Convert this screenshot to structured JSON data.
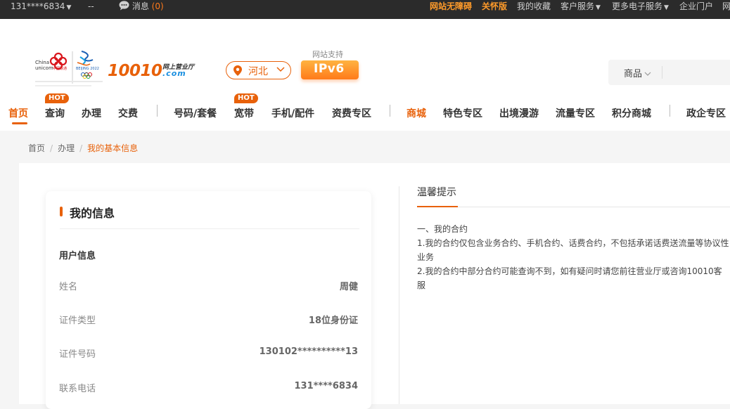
{
  "topbar": {
    "user_phone": "131****6834",
    "dash": "--",
    "messages_label": "消息",
    "messages_count": "(0)",
    "accessible": "网站无障碍",
    "care_mode": "关怀版",
    "favorites": "我的收藏",
    "customer_service": "客户服务",
    "more_services": "更多电子服务",
    "enterprise_portal": "企业门户",
    "truncated": "网"
  },
  "header": {
    "logo_text": "China unicom中国联通",
    "brand_number": "10010",
    "brand_line1": "网上营业厅",
    "brand_line2": ".com",
    "region": "河北",
    "ipv6_caption": "网站支持",
    "ipv6_label": "IPv6",
    "search_category": "商品"
  },
  "nav": {
    "items": [
      "首页",
      "查询",
      "办理",
      "交费",
      "号码/套餐",
      "宽带",
      "手机/配件",
      "资费专区",
      "商城",
      "特色专区",
      "出境漫游",
      "流量专区",
      "积分商城",
      "政企专区"
    ],
    "hot_badge": "HOT"
  },
  "breadcrumb": {
    "items": [
      "首页",
      "办理",
      "我的基本信息"
    ],
    "separator": "/"
  },
  "info_card": {
    "title": "我的信息",
    "section": "用户信息",
    "rows": [
      {
        "label": "姓名",
        "value": "周健"
      },
      {
        "label": "证件类型",
        "value": "18位身份证"
      },
      {
        "label": "证件号码",
        "value": "130102**********13"
      },
      {
        "label": "联系电话",
        "value": "131****6834"
      }
    ]
  },
  "tips": {
    "title": "温馨提示",
    "lines": [
      "一、我的合约",
      "1.我的合约仅包含业务合约、手机合约、话费合约，不包括承诺话费送流量等协议性业务",
      "2.我的合约中部分合约可能查询不到，如有疑问时请您前往营业厅或咨询10010客服"
    ]
  },
  "colors": {
    "accent": "#e8610a",
    "topbar_bg": "#2b2b2b",
    "highlight": "#ff9b2a"
  }
}
